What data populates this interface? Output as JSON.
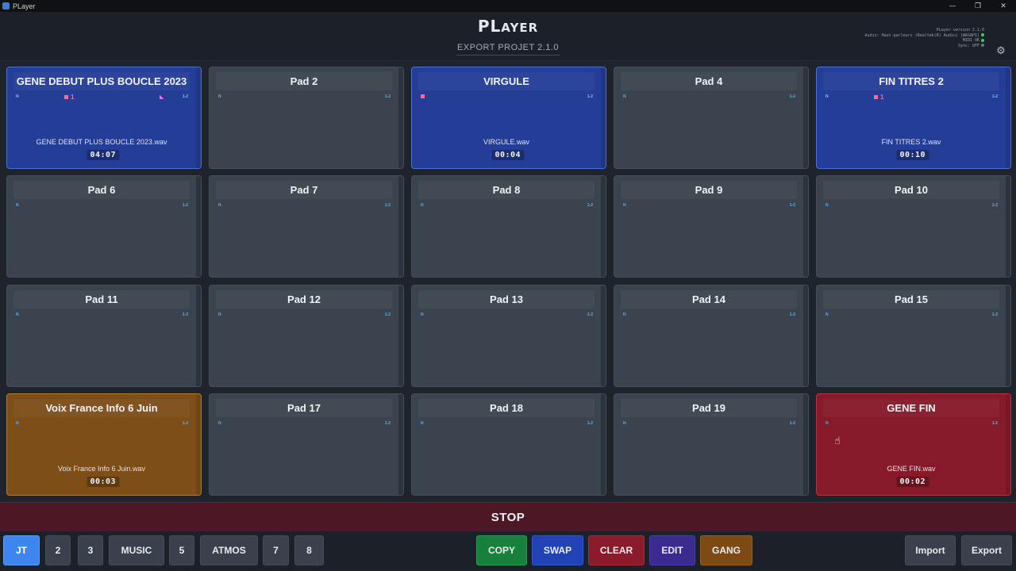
{
  "window": {
    "title": "PLayer",
    "minimize": "—",
    "restore": "❐",
    "close": "✕"
  },
  "header": {
    "brand_big": "PL",
    "brand_small": "AYER",
    "project": "EXPORT PROJET 2.1.0",
    "status_version": "PLayer version 2.1.0",
    "status_audio": "Audio: Haut-parleurs (Realtek(R) Audio) (WASAPI)",
    "status_midi": "MIDI OK",
    "status_sync": "Sync: OFF",
    "settings_icon": "gear-icon",
    "gear_glyph": "⚙"
  },
  "pad_labels": {
    "n": "N",
    "ch": "1-2",
    "loop_count": "1",
    "fade": "◣"
  },
  "pads": [
    {
      "title": "GENE DEBUT PLUS BOUCLE 2023",
      "file": "GENE DEBUT PLUS BOUCLE 2023.wav",
      "duration": "04:07",
      "color": "#243d96"
    },
    {
      "title": "Pad 2",
      "file": "",
      "duration": ""
    },
    {
      "title": "VIRGULE",
      "file": "VIRGULE.wav",
      "duration": "00:04",
      "color": "#243d96"
    },
    {
      "title": "Pad 4",
      "file": "",
      "duration": ""
    },
    {
      "title": "FIN TITRES 2",
      "file": "FIN TITRES 2.wav",
      "duration": "00:10",
      "color": "#243d96"
    },
    {
      "title": "Pad 6"
    },
    {
      "title": "Pad 7"
    },
    {
      "title": "Pad 8"
    },
    {
      "title": "Pad 9"
    },
    {
      "title": "Pad 10"
    },
    {
      "title": "Pad 11"
    },
    {
      "title": "Pad 12"
    },
    {
      "title": "Pad 13"
    },
    {
      "title": "Pad 14"
    },
    {
      "title": "Pad 15"
    },
    {
      "title": "Voix France Info 6 Juin",
      "file": "Voix France Info 6 Juin.wav",
      "duration": "00:03",
      "color": "#7d4e18"
    },
    {
      "title": "Pad 17"
    },
    {
      "title": "Pad 18"
    },
    {
      "title": "Pad 19"
    },
    {
      "title": "GENE FIN",
      "file": "GENE FIN.wav",
      "duration": "00:02",
      "color": "#861a2a"
    }
  ],
  "stop_label": "STOP",
  "banks": [
    "JT",
    "2",
    "3",
    "MUSIC",
    "5",
    "ATMOS",
    "7",
    "8"
  ],
  "active_bank": "JT",
  "actions": [
    "COPY",
    "SWAP",
    "CLEAR",
    "EDIT",
    "GANG"
  ],
  "io": [
    "Import",
    "Export"
  ],
  "cursor_glyph": "☝"
}
